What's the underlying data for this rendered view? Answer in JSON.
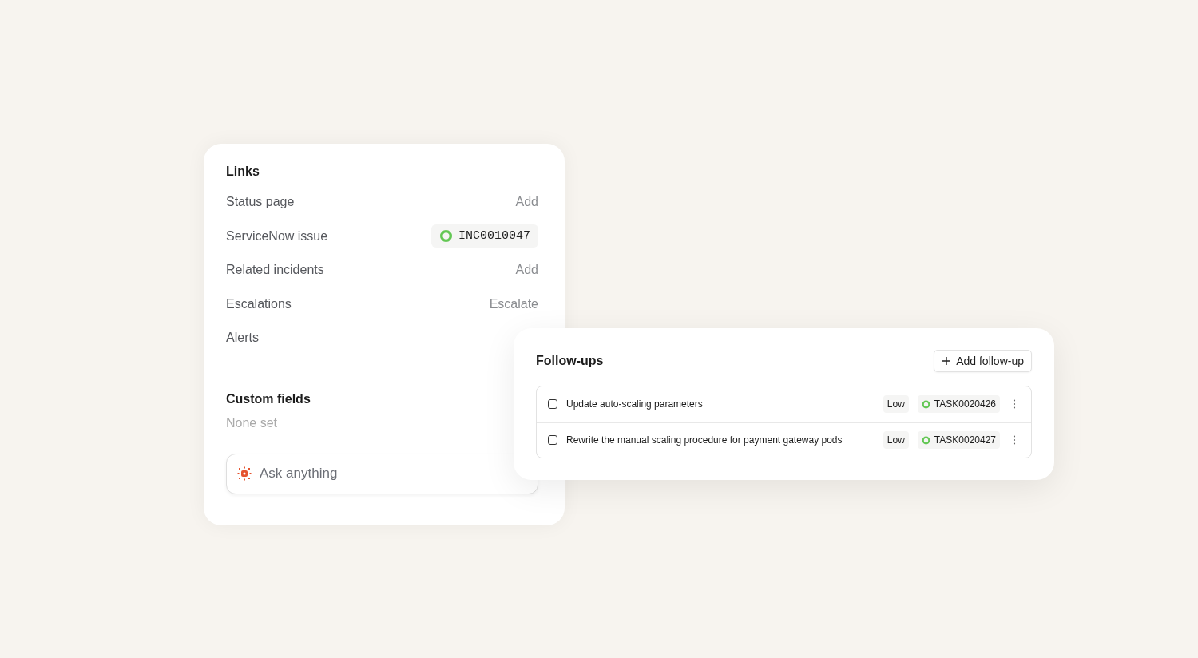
{
  "links_card": {
    "title": "Links",
    "rows": [
      {
        "label": "Status page",
        "kind": "action",
        "value": "Add"
      },
      {
        "label": "ServiceNow issue",
        "kind": "chip",
        "value": "INC0010047"
      },
      {
        "label": "Related incidents",
        "kind": "action",
        "value": "Add"
      },
      {
        "label": "Escalations",
        "kind": "action",
        "value": "Escalate"
      },
      {
        "label": "Alerts",
        "kind": "none"
      }
    ],
    "custom_fields": {
      "title": "Custom fields",
      "empty_text": "None set"
    },
    "ask": {
      "placeholder": "Ask anything"
    }
  },
  "followups_card": {
    "title": "Follow-ups",
    "add_button": "Add follow-up",
    "items": [
      {
        "title": "Update auto-scaling parameters",
        "checked": false,
        "priority": "Low",
        "ticket": "TASK0020426"
      },
      {
        "title": "Rewrite the manual scaling procedure for payment gateway pods",
        "checked": false,
        "priority": "Low",
        "ticket": "TASK0020427"
      }
    ]
  }
}
